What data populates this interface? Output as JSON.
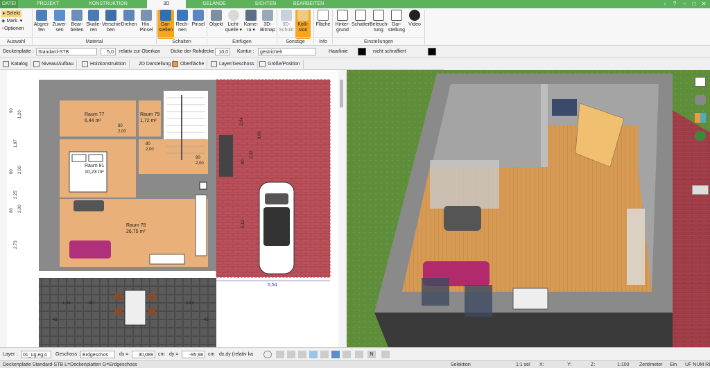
{
  "tabs": {
    "datei": "DATEI",
    "projekt": "PROJEKT",
    "konstruktion": "KONSTRUKTION",
    "d3": "3D",
    "gelaende": "GELÄNDE",
    "sichten": "SICHTEN",
    "bearbeiten": "BEARBEITEN"
  },
  "ribbon": {
    "selekt": "Selekt",
    "mark": "Mark.",
    "optionen": "Optionen",
    "abgreifen": [
      "Abgrei-",
      "fen"
    ],
    "zuweisen": [
      "Zuwei-",
      "sen"
    ],
    "bearbeiten": [
      "Bear-",
      "beiten"
    ],
    "skalieren": [
      "Skalie-",
      "ren"
    ],
    "verschieben": [
      "Verschie-",
      "ben"
    ],
    "drehen": "Drehen",
    "hinpinsel": [
      "Hin.",
      "Pinsel"
    ],
    "darstellen": [
      "Dar-",
      "stellen"
    ],
    "rechnen": [
      "Rech-",
      "nen"
    ],
    "pinsel": "Pinsel",
    "objekt": "Objekt",
    "lichtquelle": [
      "Licht-",
      "quelle"
    ],
    "kamera": [
      "Kame-",
      "ra"
    ],
    "d3bitmap": [
      "3D-",
      "Bitmap"
    ],
    "d3schnitt": [
      "3D-",
      "Schnitt"
    ],
    "kollision": [
      "Kolli-",
      "sion"
    ],
    "flaeche": "Fläche",
    "hintergrund": [
      "Hinter-",
      "grund"
    ],
    "schatten": "Schatten",
    "beleuchtung": [
      "Beleuch-",
      "tung"
    ],
    "darstellung": [
      "Dar-",
      "stellung"
    ],
    "video": "Video",
    "groups": {
      "auswahl": "Auswahl",
      "material": "Material",
      "schalten": "Schalten",
      "einfuegen": "Einfügen",
      "sonstige": "Sonstige",
      "info": "Info",
      "einstellungen": "Einstellungen"
    }
  },
  "propbar": {
    "element": "Deckenplatte :",
    "style": "Standard-STB",
    "value": "5,0",
    "relativ": "relativ zur Oberkan",
    "dicke_label": "Dicke der Rohdecke",
    "dicke": "10,0",
    "kontur": "Kontur :",
    "gestrichelt": "gestrichelt",
    "haarlinie": "Haarlinie",
    "schraffiert": "nicht schraffiert"
  },
  "toolbar2": [
    "Katalog",
    "Niveau/Aufbau",
    "Holzkonstruktion",
    "2D Darstellung",
    "Oberfläche",
    "Layer/Geschoss",
    "Größe/Position"
  ],
  "plan": {
    "rooms": [
      {
        "name": "Raum 77",
        "area": "6,44 m²"
      },
      {
        "name": "Raum 79",
        "area": "1,72 m²"
      },
      {
        "name": "Raum 81",
        "area": "10,23 m²"
      },
      {
        "name": "Raum 78",
        "area": "26,75 m²"
      }
    ],
    "dims_left": [
      "90",
      "1,20",
      "1,87",
      "80",
      "2,00",
      "2,25",
      "80",
      "2,00",
      "2,73"
    ],
    "dims_bottom": [
      "1,53",
      "90",
      "2,63",
      "43",
      "43"
    ],
    "dims_right": [
      "2,94",
      "3,90",
      "2,02",
      "90",
      "5,12"
    ],
    "garage_width": "5,54",
    "door_labels": [
      "80",
      "2,00",
      "80",
      "2,00",
      "90",
      "2,00"
    ]
  },
  "statusrow": {
    "layer_label": "Layer :",
    "layer": "01_ug,eg,o",
    "geschoss_label": "Geschoss :",
    "geschoss": "Erdgeschos",
    "dx_label": "dx =",
    "dx": "30,089",
    "dx_unit": "cm",
    "dy_label": "dy =",
    "dy": "-95,98",
    "dy_unit": "cm",
    "mode": "dx,dy (relativ ka"
  },
  "statusbar": {
    "info": "Deckenplatte Standard-STB L=Deckenplatten G=Erdgeschoss",
    "mode": "Selektion",
    "sel": "1:1 sel",
    "x": "X:",
    "y": "Y:",
    "z": "Z:",
    "scale": "1:100",
    "unit": "Zentimeter",
    "ein": "Ein",
    "flags": "UF NUM RF"
  },
  "colors": {
    "accent": "#5cb35c",
    "active": "#f5a623",
    "garage": "#b0454f"
  }
}
